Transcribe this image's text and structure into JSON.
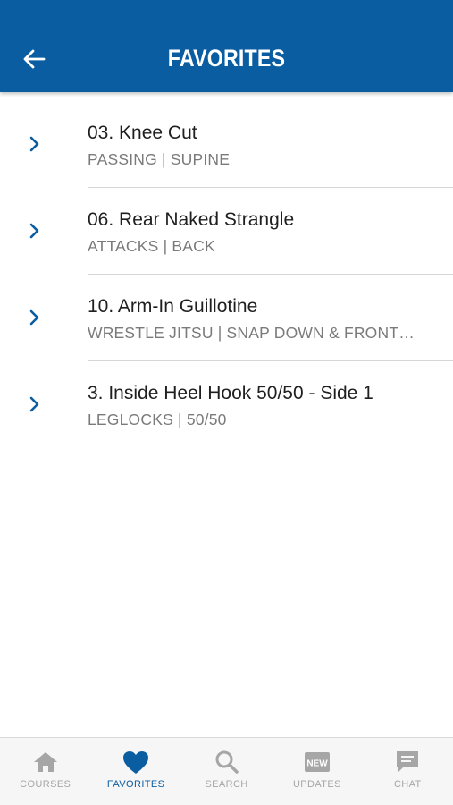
{
  "header": {
    "title": "FAVORITES",
    "back_icon": "arrow-left-icon"
  },
  "colors": {
    "brand": "#0b5da2",
    "inactive": "#a6a6a6",
    "text": "#1f1f1f",
    "subtext": "#7a7a7a"
  },
  "favorites": [
    {
      "title": "03. Knee Cut",
      "subtitle": "PASSING | SUPINE"
    },
    {
      "title": "06. Rear Naked Strangle",
      "subtitle": "ATTACKS | BACK"
    },
    {
      "title": "10. Arm-In Guillotine",
      "subtitle": "WRESTLE JITSU | SNAP DOWN & FRONT…"
    },
    {
      "title": "3. Inside Heel Hook 50/50 - Side 1",
      "subtitle": "LEGLOCKS | 50/50"
    }
  ],
  "tabbar": {
    "tabs": [
      {
        "label": "COURSES",
        "icon": "home-icon",
        "active": false
      },
      {
        "label": "FAVORITES",
        "icon": "heart-icon",
        "active": true
      },
      {
        "label": "SEARCH",
        "icon": "search-icon",
        "active": false
      },
      {
        "label": "UPDATES",
        "icon": "new-badge-icon",
        "badge_text": "NEW",
        "active": false
      },
      {
        "label": "CHAT",
        "icon": "chat-icon",
        "active": false
      }
    ]
  }
}
